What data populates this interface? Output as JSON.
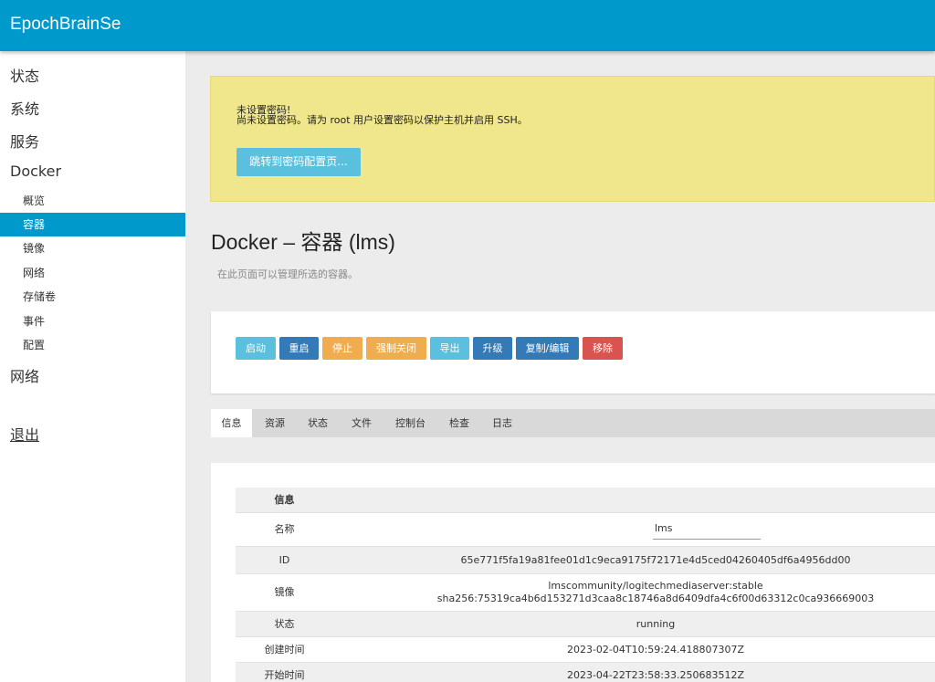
{
  "header": {
    "brand": "EpochBrainSe"
  },
  "sidebar": {
    "items": [
      "状态",
      "系统",
      "服务",
      "Docker"
    ],
    "docker_sub": [
      "概览",
      "容器",
      "镜像",
      "网络",
      "存储卷",
      "事件",
      "配置"
    ],
    "network": "网络",
    "logout": "退出"
  },
  "warning": {
    "title": "未设置密码!",
    "text": "尚未设置密码。请为 root 用户设置密码以保护主机并启用 SSH。",
    "button": "跳转到密码配置页..."
  },
  "page": {
    "title": "Docker – 容器 (lms)",
    "description": "在此页面可以管理所选的容器。"
  },
  "actions": [
    "启动",
    "重启",
    "停止",
    "强制关闭",
    "导出",
    "升级",
    "复制/编辑",
    "移除"
  ],
  "tabs": [
    "信息",
    "资源",
    "状态",
    "文件",
    "控制台",
    "检查",
    "日志"
  ],
  "info": {
    "header": "信息",
    "name_label": "名称",
    "name_value": "lms",
    "id_label": "ID",
    "id_value": "65e771f5fa19a81fee01d1c9eca9175f72171e4d5ced04260405df6a4956dd00",
    "image_label": "镜像",
    "image_value_1": "lmscommunity/logitechmediaserver:stable",
    "image_value_2": "sha256:75319ca4b6d153271d3caa8c18746a8d6409dfa4c6f00d63312c0ca936669003",
    "status_label": "状态",
    "status_value": "running",
    "created_label": "创建时间",
    "created_value": "2023-02-04T10:59:24.418807307Z",
    "started_label": "开始时间",
    "started_value": "2023-04-22T23:58:33.250683512Z"
  },
  "colors": {
    "header": "#0099cc",
    "warning_bg": "#f0e68c",
    "btn_info": "#5bc0de",
    "btn_primary": "#337ab7",
    "btn_warning": "#f0ad4e",
    "btn_danger": "#d9534f"
  }
}
